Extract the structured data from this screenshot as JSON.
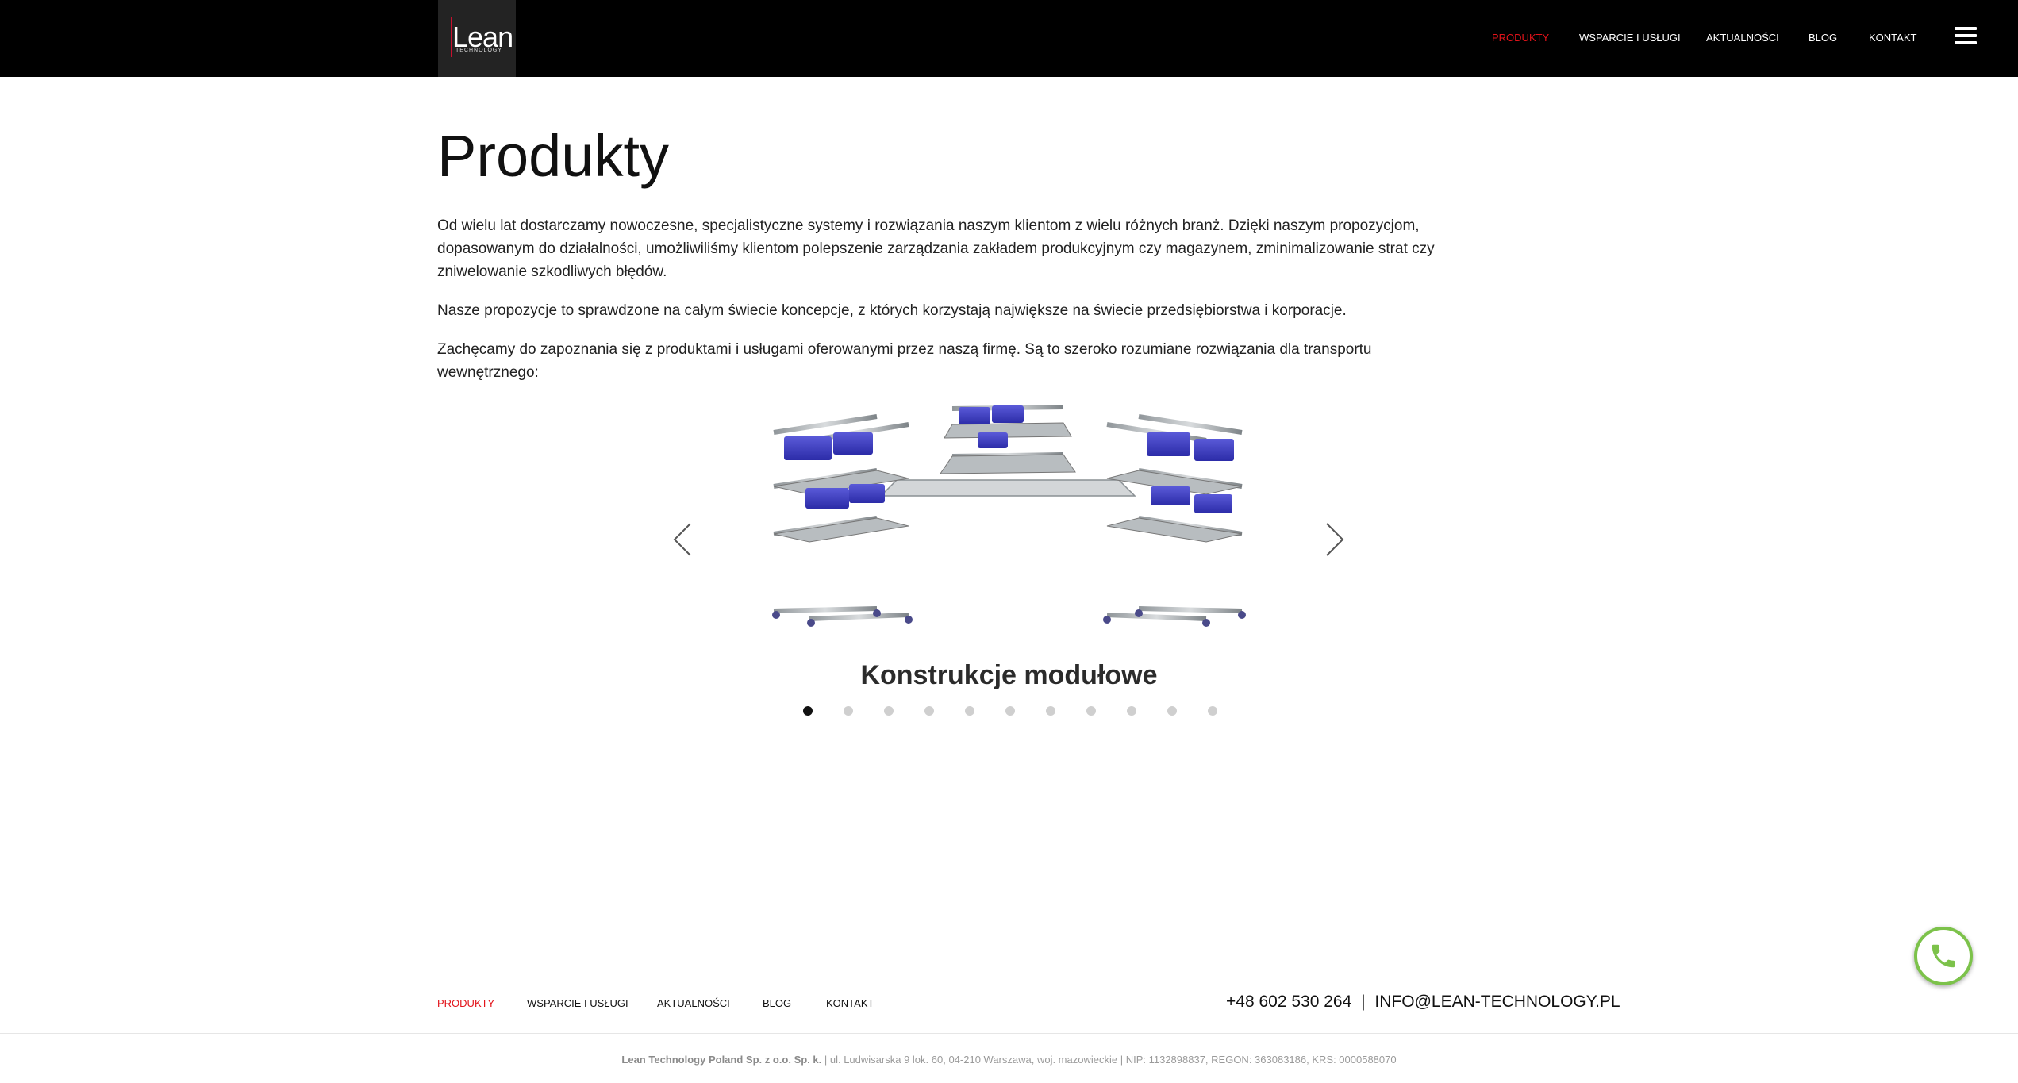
{
  "header": {
    "logo": {
      "main": "Lean",
      "sub": "TECHNOLOGY"
    },
    "nav": [
      {
        "label": "PRODUKTY",
        "active": true
      },
      {
        "label": "WSPARCIE I USŁUGI",
        "active": false
      },
      {
        "label": "AKTUALNOŚCI",
        "active": false
      },
      {
        "label": "BLOG",
        "active": false
      },
      {
        "label": "KONTAKT",
        "active": false
      }
    ],
    "menu_icon": "hamburger-menu-icon"
  },
  "main": {
    "title": "Produkty",
    "paragraphs": [
      "Od wielu lat dostarczamy nowoczesne, specjalistyczne systemy i rozwiązania naszym klientom z wielu różnych branż. Dzięki naszym propozycjom, dopasowanym do działalności, umożliwiliśmy klientom polepszenie zarządzania zakładem produkcyjnym czy magazynem, zminimalizowanie strat czy zniwelowanie szkodliwych błędów.",
      "Nasze propozycje to sprawdzone na całym świecie koncepcje, z których korzystają największe na świecie przedsiębiorstwa i korporacje.",
      "Zachęcamy do zapoznania się z produktami i usługami oferowanymi przez naszą firmę. Są to szeroko rozumiane rozwiązania dla transportu wewnętrznego:"
    ]
  },
  "slider": {
    "slide_title": "Konstrukcje modułowe",
    "prev_icon": "chevron-left-icon",
    "next_icon": "chevron-right-icon",
    "dot_count": 11,
    "active_index": 0
  },
  "phone_button": {
    "icon": "phone-icon"
  },
  "footer": {
    "nav": [
      {
        "label": "PRODUKTY",
        "active": true
      },
      {
        "label": "WSPARCIE I USŁUGI",
        "active": false
      },
      {
        "label": "AKTUALNOŚCI",
        "active": false
      },
      {
        "label": "BLOG",
        "active": false
      },
      {
        "label": "KONTAKT",
        "active": false
      }
    ],
    "phone_prefix": "+48",
    "phone_number": "602 530 264",
    "separator": "|",
    "email": "INFO@LEAN-TECHNOLOGY.PL",
    "company": "Lean Technology Poland Sp. z o.o. Sp. k.",
    "legal": "| ul. Ludwisarska 9 lok. 60, 04-210 Warszawa, woj. mazowieckie | NIP: 1132898837, REGON: 363083186, KRS: 0000588070"
  },
  "colors": {
    "accent_red": "#e2131a",
    "phone_green": "#7cc24a",
    "header_bg": "#000000"
  }
}
